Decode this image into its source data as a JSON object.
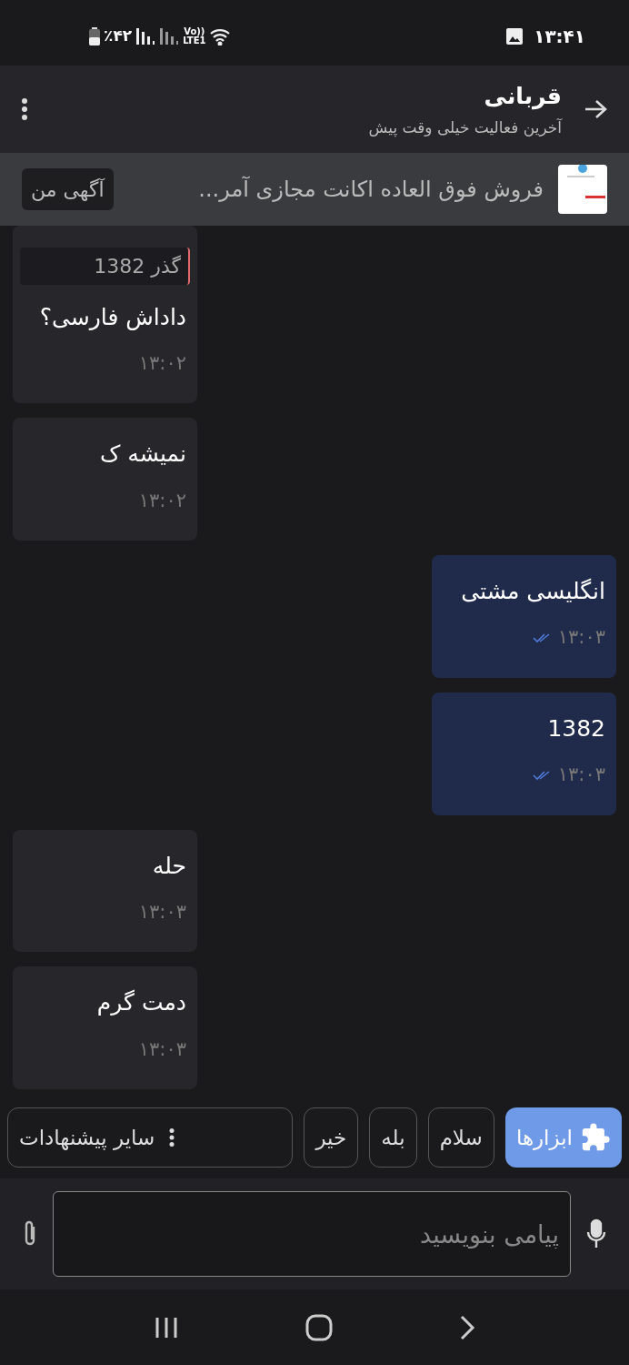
{
  "status_bar": {
    "battery": "٪۴۲",
    "network": "Vo))",
    "network_sub": "LTE1",
    "time": "۱۳:۴۱"
  },
  "header": {
    "title": "قربانی",
    "subtitle": "آخرین فعالیت خیلی وقت پیش"
  },
  "ad": {
    "text": "فروش فوق العاده اکانت مجازی آمر...",
    "button": "آگهی من"
  },
  "messages": [
    {
      "outgoing": false,
      "quote": "گذر 1382",
      "text": "داداش فارسی؟",
      "time": "۱۳:۰۲"
    },
    {
      "outgoing": false,
      "text": "نمیشه ک",
      "time": "۱۳:۰۲"
    },
    {
      "outgoing": true,
      "text": "انگلیسی مشتی",
      "time": "۱۳:۰۳"
    },
    {
      "outgoing": true,
      "text": "1382",
      "time": "۱۳:۰۳"
    },
    {
      "outgoing": false,
      "text": "حله",
      "time": "۱۳:۰۳"
    },
    {
      "outgoing": false,
      "text": "دمت گرم",
      "time": "۱۳:۰۳"
    }
  ],
  "suggestions": [
    {
      "kind": "tools",
      "label": "ابزارها"
    },
    {
      "kind": "reply",
      "label": "سلام"
    },
    {
      "kind": "reply",
      "label": "بله"
    },
    {
      "kind": "reply",
      "label": "خیر"
    },
    {
      "kind": "more",
      "label": "سایر پیشنهادات"
    }
  ],
  "composer": {
    "placeholder": "پیامی بنویسید"
  }
}
